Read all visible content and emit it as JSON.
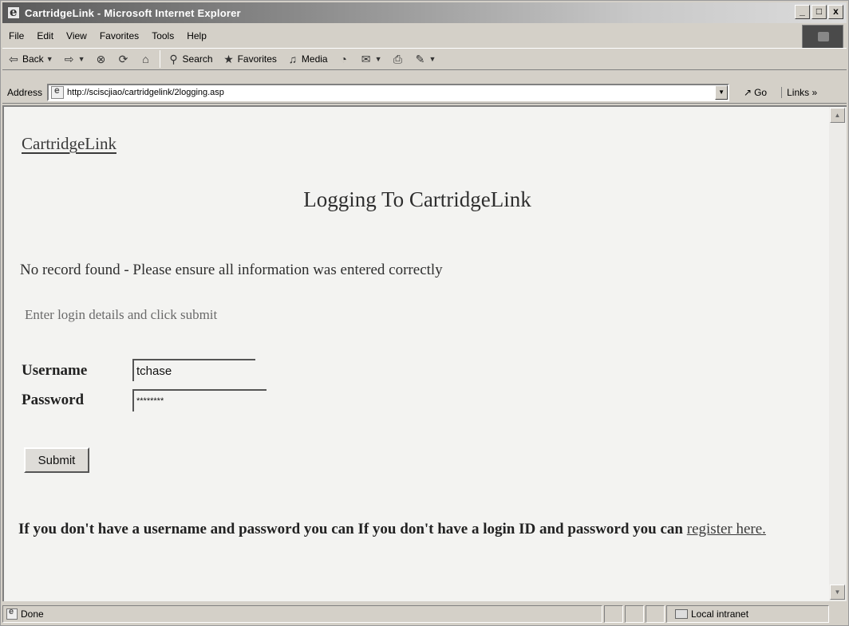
{
  "window": {
    "title": "CartridgeLink - Microsoft Internet Explorer",
    "controls": {
      "minimize": "_",
      "maximize": "□",
      "close": "x"
    }
  },
  "menu": [
    "File",
    "Edit",
    "View",
    "Favorites",
    "Tools",
    "Help"
  ],
  "toolbar": {
    "back": "Back",
    "search": "Search",
    "favorites": "Favorites",
    "media": "Media"
  },
  "address": {
    "label": "Address",
    "url": "http://sciscjiao/cartridgelink/2logging.asp",
    "go": "Go",
    "links": "Links »"
  },
  "page": {
    "site_link": "CartridgeLink",
    "title": "Logging To CartridgeLink",
    "error": "No record found - Please ensure all information was entered correctly",
    "instruction": "Enter login details and click submit",
    "username_label": "Username",
    "username_value": "tchase",
    "password_label": "Password",
    "password_value": "********",
    "submit": "Submit",
    "footer_text": "If you don't have a username and password you can If you don't have a login ID and password you can ",
    "register_link": "register here."
  },
  "status": {
    "text": "Done",
    "zone": "Local intranet"
  },
  "icons": {
    "back": "arrow-left-icon",
    "forward": "arrow-right-icon",
    "stop": "stop-icon",
    "refresh": "refresh-icon",
    "home": "home-icon",
    "search": "search-icon",
    "favorites": "favorites-icon",
    "media": "media-icon",
    "history": "history-icon",
    "mail": "mail-icon",
    "print": "print-icon",
    "edit": "edit-icon"
  }
}
